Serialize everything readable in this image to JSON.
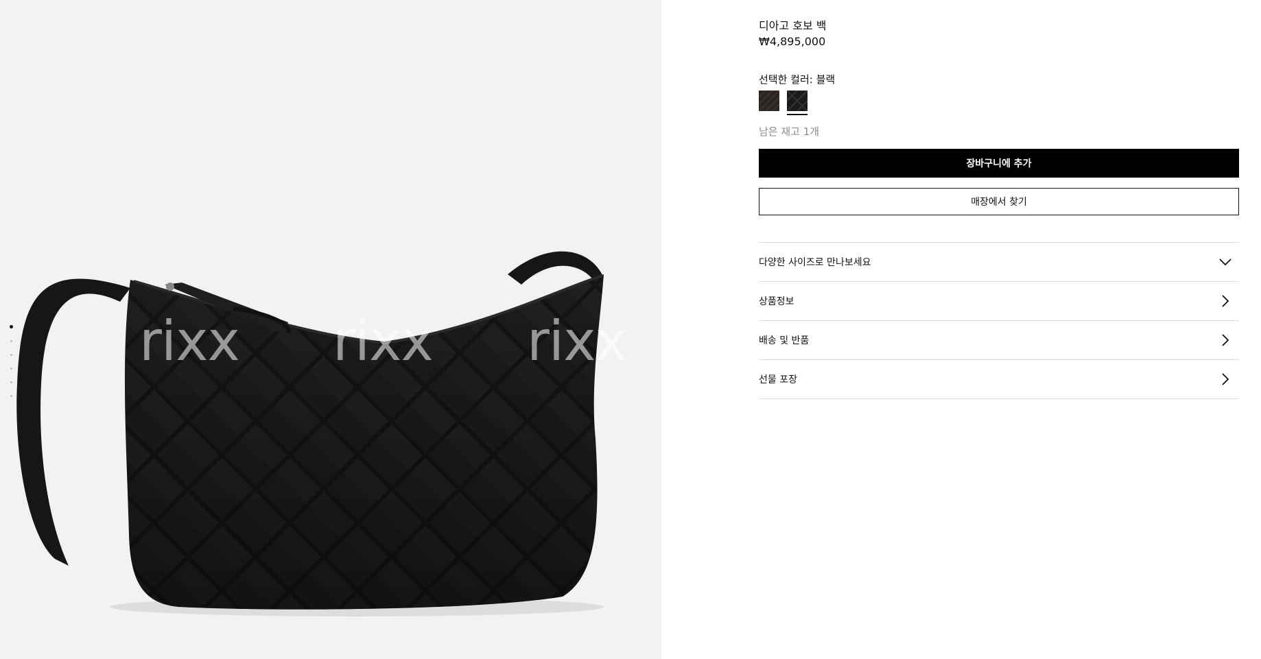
{
  "watermark": {
    "text": "rixx"
  },
  "gallery": {
    "slide_count": 6,
    "active_index": 0
  },
  "product": {
    "title": "디아고 호보 백",
    "price": "₩4,895,000"
  },
  "color": {
    "label": "선택한 컬러: 블랙",
    "swatches": [
      {
        "name": "dark-brown",
        "color": "#2b2522",
        "selected": false
      },
      {
        "name": "black",
        "color": "#1b1b1b",
        "selected": true
      }
    ]
  },
  "stock_text": "남은 재고 1개",
  "buttons": {
    "add_to_cart": "장바구니에 추가",
    "find_in_store": "매장에서 찾기"
  },
  "accordion": [
    {
      "label": "다양한 사이즈로 만나보세요",
      "icon": "chevron-down-icon"
    },
    {
      "label": "상품정보",
      "icon": "chevron-right-icon"
    },
    {
      "label": "배송 및 반품",
      "icon": "chevron-right-icon"
    },
    {
      "label": "선물 포장",
      "icon": "chevron-right-icon"
    }
  ],
  "colors": {
    "accent": "#000000",
    "gallery_bg": "#f1f3f2",
    "divider": "#dcdcdc",
    "muted_text": "#8a8a8a"
  }
}
